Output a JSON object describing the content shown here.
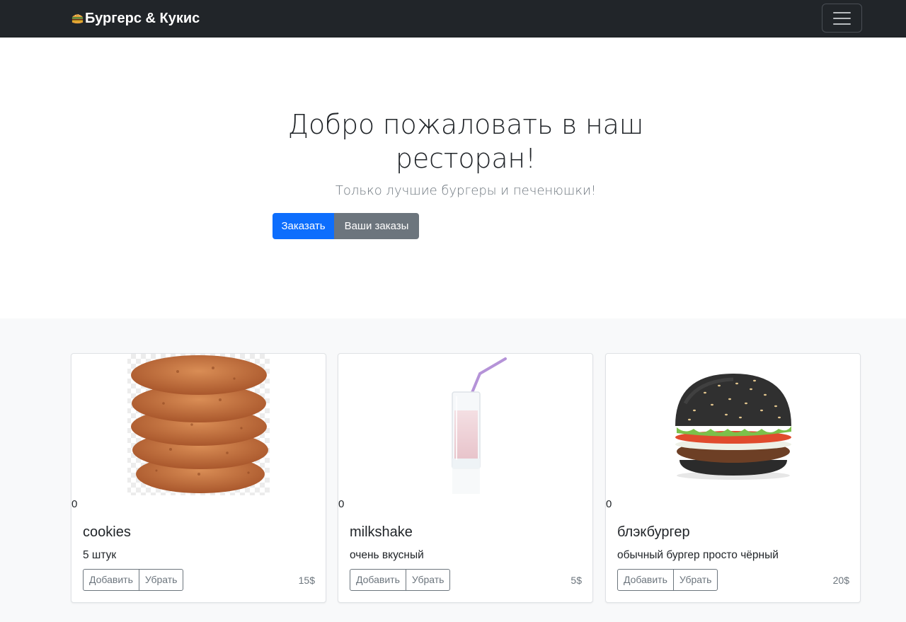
{
  "navbar": {
    "brand": "Бургерс & Кукис",
    "brand_icon": "burger-icon",
    "toggler_icon": "hamburger-menu-icon"
  },
  "hero": {
    "title": "Добро пожаловать в наш ресторан!",
    "lead": "Только лучшие бургеры и печенюшки!",
    "order_button": "Заказать",
    "your_orders_button": "Ваши заказы"
  },
  "products": [
    {
      "count": "0",
      "title": "cookies",
      "description": "5 штук",
      "add_label": "Добавить",
      "remove_label": "Убрать",
      "price": "15$",
      "image": "cookies-stack-image"
    },
    {
      "count": "0",
      "title": "milkshake",
      "description": "очень вкусный",
      "add_label": "Добавить",
      "remove_label": "Убрать",
      "price": "5$",
      "image": "milkshake-glass-image"
    },
    {
      "count": "0",
      "title": "блэкбургер",
      "description": "обычный бургер просто чёрный",
      "add_label": "Добавить",
      "remove_label": "Убрать",
      "price": "20$",
      "image": "black-burger-image"
    }
  ],
  "colors": {
    "navbar_bg": "#212529",
    "primary": "#0d6efd",
    "secondary": "#6c757d",
    "album_bg": "#f8f9fa"
  }
}
